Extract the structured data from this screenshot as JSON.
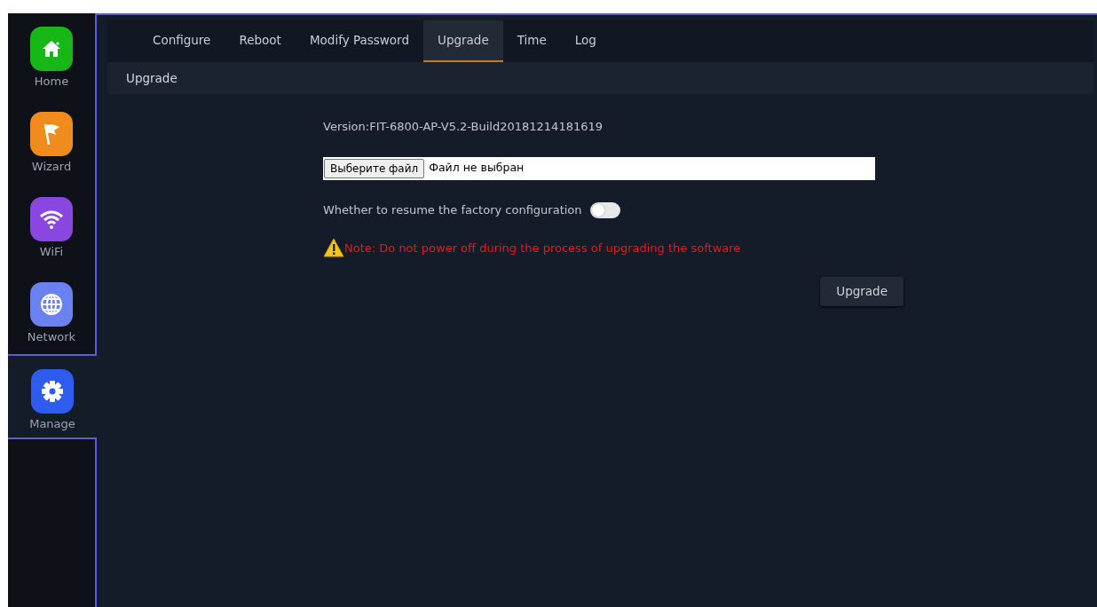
{
  "sidebar": {
    "items": [
      {
        "label": "Home",
        "kind": "home",
        "color": "#16b716",
        "selected": false
      },
      {
        "label": "Wizard",
        "kind": "flag",
        "color": "#f08c1e",
        "selected": false
      },
      {
        "label": "WiFi",
        "kind": "wifi",
        "color": "#8a46e0",
        "selected": false
      },
      {
        "label": "Network",
        "kind": "globe",
        "color": "#6a82f0",
        "selected": false
      },
      {
        "label": "Manage",
        "kind": "gear",
        "color": "#2f5cf0",
        "selected": true
      }
    ]
  },
  "tabs": [
    {
      "label": "Configure",
      "selected": false
    },
    {
      "label": "Reboot",
      "selected": false
    },
    {
      "label": "Modify Password",
      "selected": false
    },
    {
      "label": "Upgrade",
      "selected": true
    },
    {
      "label": "Time",
      "selected": false
    },
    {
      "label": "Log",
      "selected": false
    }
  ],
  "section_title": "Upgrade",
  "version": "Version:FIT-6800-AP-V5.2-Build20181214181619",
  "file_input": {
    "button": "Выберите файл",
    "status": "Файл не выбран"
  },
  "factory_reset": {
    "label": "Whether to resume the factory configuration",
    "on": false
  },
  "note": "Note: Do not power off during the process of upgrading the software",
  "upgrade_button": "Upgrade"
}
